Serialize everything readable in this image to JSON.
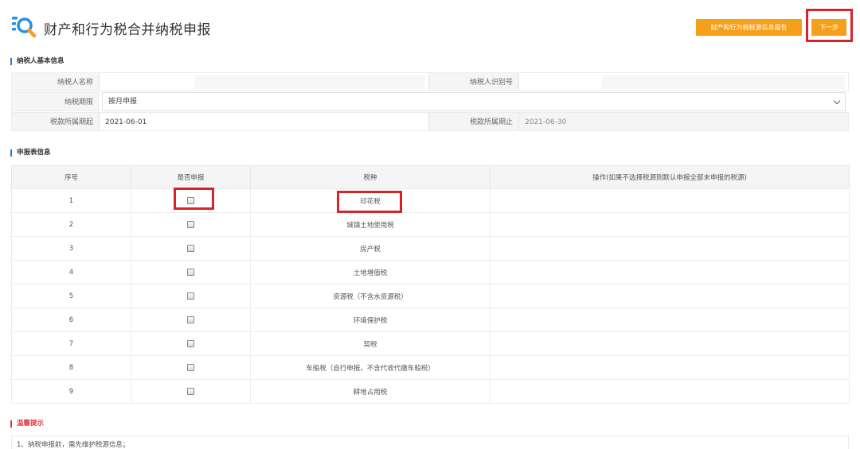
{
  "page": {
    "title": "财产和行为税合并纳税申报",
    "report_button": "财产和行为税税源信息报告",
    "next_button": "下一步"
  },
  "basic_info": {
    "section_title": "纳税人基本信息",
    "taxpayer_name_label": "纳税人名称",
    "taxpayer_name": "",
    "taxpayer_id_label": "纳税人识别号",
    "taxpayer_id": "",
    "period_label": "纳税期限",
    "period_value": "按月申报",
    "start_label": "税款所属期起",
    "start_value": "2021-06-01",
    "end_label": "税款所属期止",
    "end_value": "2021-06-30"
  },
  "declaration": {
    "section_title": "申报表信息",
    "columns": [
      "序号",
      "是否申报",
      "税种",
      "操作(如果不选择税源则默认申报全部未申报的税源)"
    ],
    "rows": [
      {
        "no": "1",
        "tax": "印花税",
        "checked": false
      },
      {
        "no": "2",
        "tax": "城镇土地使用税",
        "checked": false
      },
      {
        "no": "3",
        "tax": "房产税",
        "checked": false
      },
      {
        "no": "4",
        "tax": "土地增值税",
        "checked": false
      },
      {
        "no": "5",
        "tax": "资源税（不含水资源税）",
        "checked": false
      },
      {
        "no": "6",
        "tax": "环境保护税",
        "checked": false
      },
      {
        "no": "7",
        "tax": "契税",
        "checked": false
      },
      {
        "no": "8",
        "tax": "车船税（自行申报，不含代收代缴车船税）",
        "checked": false
      },
      {
        "no": "9",
        "tax": "耕地占用税",
        "checked": false
      }
    ]
  },
  "tips": {
    "section_title": "温馨提示",
    "text": "1、纳税申报前，需先维护税源信息；"
  },
  "colors": {
    "accent_orange": "#f5a01a",
    "highlight_red": "#d9232b",
    "section_blue": "#2b7ad0"
  },
  "icons": {
    "logo": "search-list-icon",
    "select_arrow": "chevron-down-icon",
    "row_checkbox": "checkbox-icon"
  }
}
